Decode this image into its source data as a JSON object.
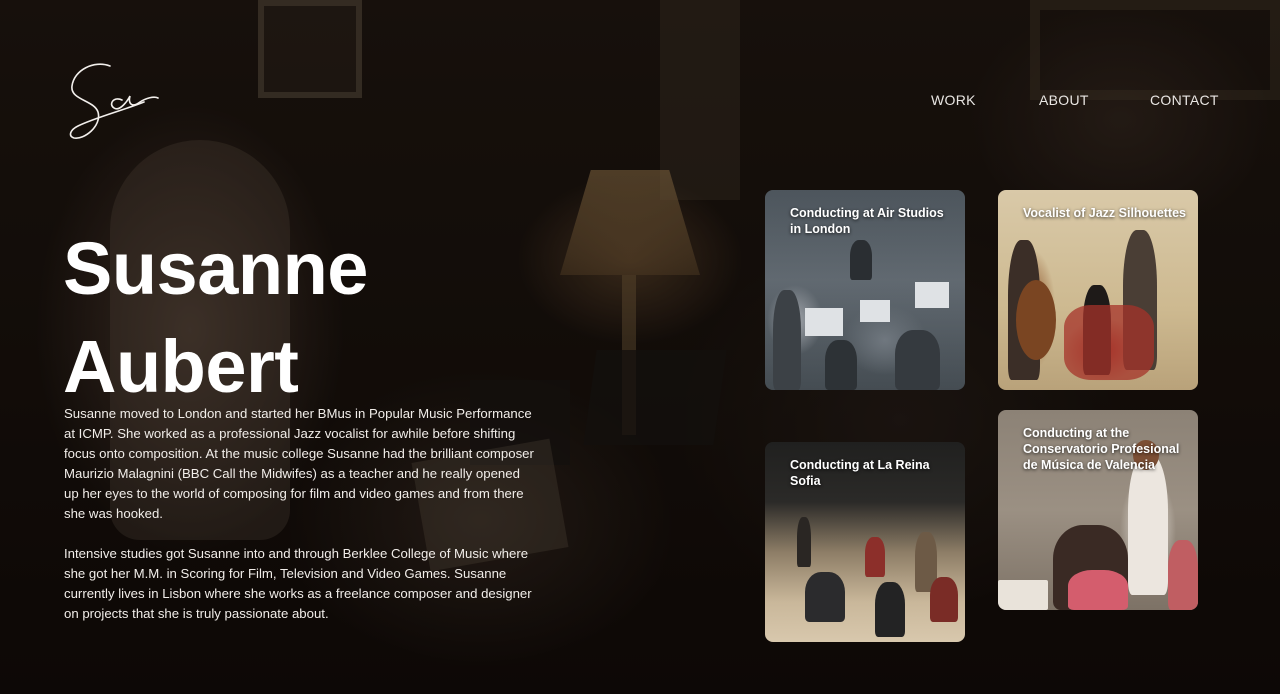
{
  "header": {
    "logo_text": "Sa",
    "nav": [
      {
        "label": "WORK"
      },
      {
        "label": "ABOUT"
      },
      {
        "label": "CONTACT"
      }
    ]
  },
  "hero": {
    "first_name": "Susanne",
    "last_name": "Aubert",
    "bio": [
      "Susanne moved to London and started her BMus in Popular Music Performance at ICMP. She worked as a professional Jazz vocalist for awhile before shifting focus onto composition. At the music college Susanne had the brilliant composer Maurizio Malagnini (BBC Call the Midwifes) as a teacher and he really opened up her eyes to the world of composing for film and video games and from there she was hooked.",
      "Intensive studies got Susanne into and through Berklee College of Music where she got her M.M. in Scoring for Film, Television and Video Games. Susanne currently lives in Lisbon where she works as a freelance composer and designer on projects that she is truly passionate about."
    ]
  },
  "cards": [
    {
      "title": "Conducting at Air Studios in London"
    },
    {
      "title": "Vocalist of Jazz Silhouettes"
    },
    {
      "title": "Conducting at La Reina Sofia"
    },
    {
      "title": "Conducting at the Conservatorio Profesional de Música de Valencia"
    }
  ],
  "colors": {
    "background": "#150e0b",
    "text": "#ffffff",
    "nav_text": "#e9e6e3"
  }
}
